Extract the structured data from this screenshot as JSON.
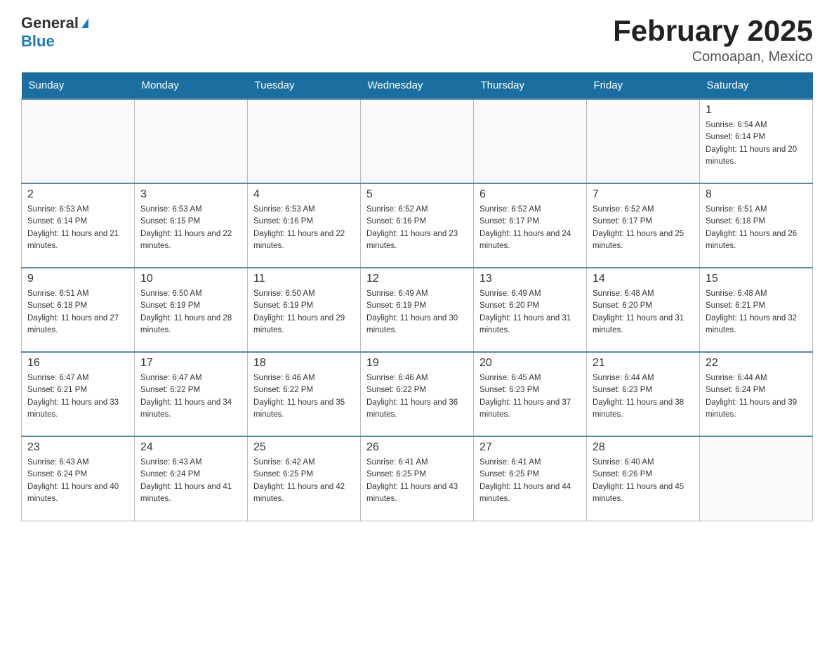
{
  "header": {
    "logo_general": "General",
    "logo_blue": "Blue",
    "month_year": "February 2025",
    "location": "Comoapan, Mexico"
  },
  "weekdays": [
    "Sunday",
    "Monday",
    "Tuesday",
    "Wednesday",
    "Thursday",
    "Friday",
    "Saturday"
  ],
  "weeks": [
    [
      {
        "day": "",
        "info": ""
      },
      {
        "day": "",
        "info": ""
      },
      {
        "day": "",
        "info": ""
      },
      {
        "day": "",
        "info": ""
      },
      {
        "day": "",
        "info": ""
      },
      {
        "day": "",
        "info": ""
      },
      {
        "day": "1",
        "info": "Sunrise: 6:54 AM\nSunset: 6:14 PM\nDaylight: 11 hours and 20 minutes."
      }
    ],
    [
      {
        "day": "2",
        "info": "Sunrise: 6:53 AM\nSunset: 6:14 PM\nDaylight: 11 hours and 21 minutes."
      },
      {
        "day": "3",
        "info": "Sunrise: 6:53 AM\nSunset: 6:15 PM\nDaylight: 11 hours and 22 minutes."
      },
      {
        "day": "4",
        "info": "Sunrise: 6:53 AM\nSunset: 6:16 PM\nDaylight: 11 hours and 22 minutes."
      },
      {
        "day": "5",
        "info": "Sunrise: 6:52 AM\nSunset: 6:16 PM\nDaylight: 11 hours and 23 minutes."
      },
      {
        "day": "6",
        "info": "Sunrise: 6:52 AM\nSunset: 6:17 PM\nDaylight: 11 hours and 24 minutes."
      },
      {
        "day": "7",
        "info": "Sunrise: 6:52 AM\nSunset: 6:17 PM\nDaylight: 11 hours and 25 minutes."
      },
      {
        "day": "8",
        "info": "Sunrise: 6:51 AM\nSunset: 6:18 PM\nDaylight: 11 hours and 26 minutes."
      }
    ],
    [
      {
        "day": "9",
        "info": "Sunrise: 6:51 AM\nSunset: 6:18 PM\nDaylight: 11 hours and 27 minutes."
      },
      {
        "day": "10",
        "info": "Sunrise: 6:50 AM\nSunset: 6:19 PM\nDaylight: 11 hours and 28 minutes."
      },
      {
        "day": "11",
        "info": "Sunrise: 6:50 AM\nSunset: 6:19 PM\nDaylight: 11 hours and 29 minutes."
      },
      {
        "day": "12",
        "info": "Sunrise: 6:49 AM\nSunset: 6:19 PM\nDaylight: 11 hours and 30 minutes."
      },
      {
        "day": "13",
        "info": "Sunrise: 6:49 AM\nSunset: 6:20 PM\nDaylight: 11 hours and 31 minutes."
      },
      {
        "day": "14",
        "info": "Sunrise: 6:48 AM\nSunset: 6:20 PM\nDaylight: 11 hours and 31 minutes."
      },
      {
        "day": "15",
        "info": "Sunrise: 6:48 AM\nSunset: 6:21 PM\nDaylight: 11 hours and 32 minutes."
      }
    ],
    [
      {
        "day": "16",
        "info": "Sunrise: 6:47 AM\nSunset: 6:21 PM\nDaylight: 11 hours and 33 minutes."
      },
      {
        "day": "17",
        "info": "Sunrise: 6:47 AM\nSunset: 6:22 PM\nDaylight: 11 hours and 34 minutes."
      },
      {
        "day": "18",
        "info": "Sunrise: 6:46 AM\nSunset: 6:22 PM\nDaylight: 11 hours and 35 minutes."
      },
      {
        "day": "19",
        "info": "Sunrise: 6:46 AM\nSunset: 6:22 PM\nDaylight: 11 hours and 36 minutes."
      },
      {
        "day": "20",
        "info": "Sunrise: 6:45 AM\nSunset: 6:23 PM\nDaylight: 11 hours and 37 minutes."
      },
      {
        "day": "21",
        "info": "Sunrise: 6:44 AM\nSunset: 6:23 PM\nDaylight: 11 hours and 38 minutes."
      },
      {
        "day": "22",
        "info": "Sunrise: 6:44 AM\nSunset: 6:24 PM\nDaylight: 11 hours and 39 minutes."
      }
    ],
    [
      {
        "day": "23",
        "info": "Sunrise: 6:43 AM\nSunset: 6:24 PM\nDaylight: 11 hours and 40 minutes."
      },
      {
        "day": "24",
        "info": "Sunrise: 6:43 AM\nSunset: 6:24 PM\nDaylight: 11 hours and 41 minutes."
      },
      {
        "day": "25",
        "info": "Sunrise: 6:42 AM\nSunset: 6:25 PM\nDaylight: 11 hours and 42 minutes."
      },
      {
        "day": "26",
        "info": "Sunrise: 6:41 AM\nSunset: 6:25 PM\nDaylight: 11 hours and 43 minutes."
      },
      {
        "day": "27",
        "info": "Sunrise: 6:41 AM\nSunset: 6:25 PM\nDaylight: 11 hours and 44 minutes."
      },
      {
        "day": "28",
        "info": "Sunrise: 6:40 AM\nSunset: 6:26 PM\nDaylight: 11 hours and 45 minutes."
      },
      {
        "day": "",
        "info": ""
      }
    ]
  ]
}
